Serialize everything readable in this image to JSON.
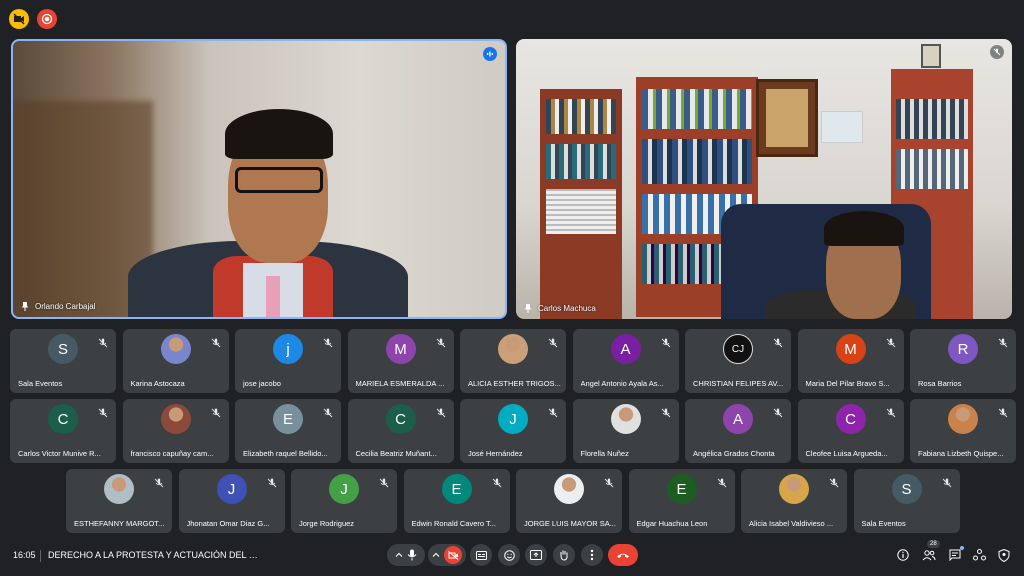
{
  "top_icons": [
    "rec-icon",
    "live-icon"
  ],
  "main_videos": [
    {
      "name": "Orlando Carbajal",
      "status": "speaking"
    },
    {
      "name": "Carlos Machuca",
      "status": "muted"
    }
  ],
  "tiles_row1": [
    {
      "name": "Sala Eventos",
      "initial": "S",
      "color": "#455a64"
    },
    {
      "name": "Karina Astocaza",
      "initial": "",
      "color": "#7986cb",
      "photo": true
    },
    {
      "name": "jose jacobo",
      "initial": "j",
      "color": "#1e88e5"
    },
    {
      "name": "MARIELA ESMERALDA ...",
      "initial": "M",
      "color": "#8e44ad"
    },
    {
      "name": "ALICIA ESTHER TRIGOS...",
      "initial": "",
      "color": "#c9a07a",
      "photo": true
    },
    {
      "name": "Angel Antonio Ayala As...",
      "initial": "A",
      "color": "#7b1fa2"
    },
    {
      "name": "CHRISTIAN FELIPES AV...",
      "initial": "CJ",
      "color": "#111111",
      "photo": true
    },
    {
      "name": "Maria Del Pilar Bravo S...",
      "initial": "M",
      "color": "#d84315"
    },
    {
      "name": "Rosa Barrios",
      "initial": "R",
      "color": "#7e57c2"
    }
  ],
  "tiles_row2": [
    {
      "name": "Carlos Victor Munive R...",
      "initial": "C",
      "color": "#1b5e4a"
    },
    {
      "name": "francisco capuñay cam...",
      "initial": "",
      "color": "#8d4a3a",
      "photo": true
    },
    {
      "name": "Elizabeth raquel Bellido...",
      "initial": "E",
      "color": "#78909c"
    },
    {
      "name": "Cecilia Beatriz Muñant...",
      "initial": "C",
      "color": "#1b5e4a"
    },
    {
      "name": "José Hernández",
      "initial": "J",
      "color": "#00acc1"
    },
    {
      "name": "Florella Nuñez",
      "initial": "",
      "color": "#e0e0e0",
      "photo": true
    },
    {
      "name": "Angélica Grados Chonta",
      "initial": "A",
      "color": "#8e44ad"
    },
    {
      "name": "Cleofee Luisa Argueda...",
      "initial": "C",
      "color": "#8e24aa"
    },
    {
      "name": "Fabiana Lizbeth Quispe...",
      "initial": "",
      "color": "#c8824a",
      "photo": true
    }
  ],
  "tiles_row3": [
    {
      "name": "ESTHEFANNY MARGOT...",
      "initial": "",
      "color": "#b0bec5",
      "photo": true
    },
    {
      "name": "Jhonatan Omar Diaz G...",
      "initial": "J",
      "color": "#3f51b5"
    },
    {
      "name": "Jorge Rodriguez",
      "initial": "J",
      "color": "#43a047"
    },
    {
      "name": "Edwin Ronald Cavero T...",
      "initial": "E",
      "color": "#00897b"
    },
    {
      "name": "JORGE LUIS MAYOR SA...",
      "initial": "",
      "color": "#eceff1",
      "photo": true
    },
    {
      "name": "Edgar Huachua Leon",
      "initial": "E",
      "color": "#1b5e20"
    },
    {
      "name": "Alicia Isabel Valdivieso ...",
      "initial": "",
      "color": "#d8a64a",
      "photo": true
    },
    {
      "name": "Sala Eventos",
      "initial": "S",
      "color": "#455a64"
    }
  ],
  "bottom_bar": {
    "time": "16:05",
    "title": "DERECHO A LA PROTESTA Y ACTUACIÓN DEL MINI...",
    "participants_count": "28"
  }
}
